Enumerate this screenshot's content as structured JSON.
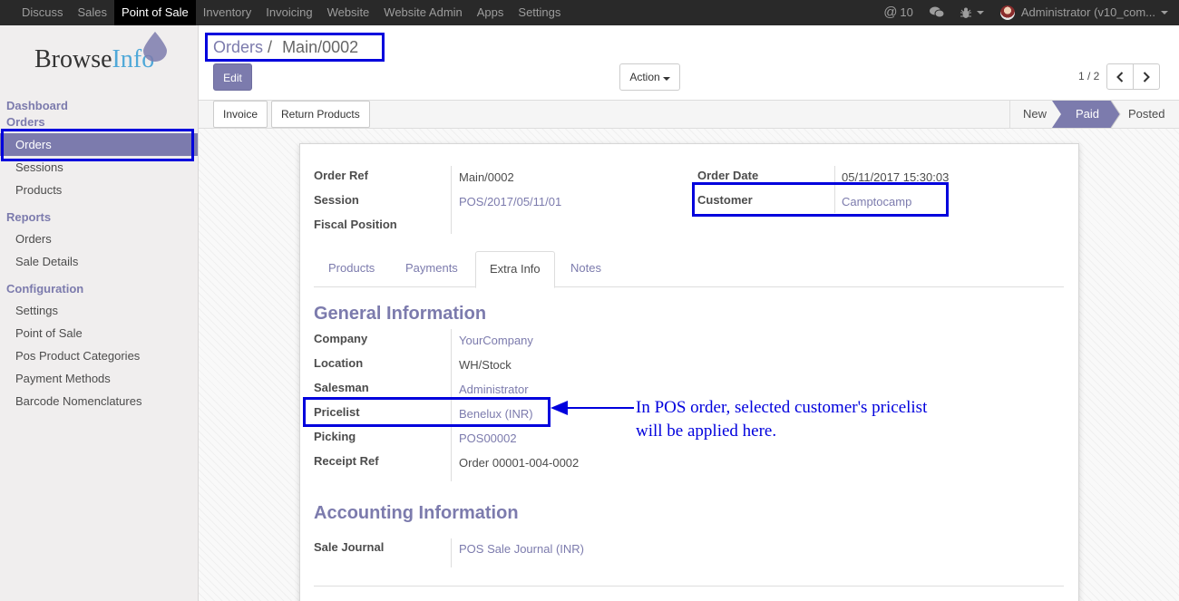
{
  "topbar": {
    "menu": [
      "Discuss",
      "Sales",
      "Point of Sale",
      "Inventory",
      "Invoicing",
      "Website",
      "Website Admin",
      "Apps",
      "Settings"
    ],
    "active_index": 2,
    "messages_count": "10",
    "user": "Administrator (v10_com..."
  },
  "sidebar": {
    "logo_browse": "Browse",
    "logo_info": "Info",
    "sections": [
      {
        "title": "Dashboard"
      },
      {
        "title": "Orders",
        "items": [
          "Orders",
          "Sessions",
          "Products"
        ]
      },
      {
        "title": "Reports",
        "items": [
          "Orders",
          "Sale Details"
        ]
      },
      {
        "title": "Configuration",
        "items": [
          "Settings",
          "Point of Sale",
          "Pos Product Categories",
          "Payment Methods",
          "Barcode Nomenclatures"
        ]
      }
    ]
  },
  "control_panel": {
    "breadcrumb_parent": "Orders",
    "breadcrumb_sep": "/",
    "breadcrumb_current": "Main/0002",
    "edit_label": "Edit",
    "action_label": "Action",
    "pager": "1 / 2"
  },
  "statusbar": {
    "buttons": [
      "Invoice",
      "Return Products"
    ],
    "stages": [
      "New",
      "Paid",
      "Posted"
    ],
    "active_stage": "Paid"
  },
  "form": {
    "order_ref_label": "Order Ref",
    "order_ref": "Main/0002",
    "session_label": "Session",
    "session": "POS/2017/05/11/01",
    "fiscal_position_label": "Fiscal Position",
    "order_date_label": "Order Date",
    "order_date": "05/11/2017 15:30:03",
    "customer_label": "Customer",
    "customer": "Camptocamp",
    "tabs": [
      "Products",
      "Payments",
      "Extra Info",
      "Notes"
    ],
    "active_tab": "Extra Info",
    "general_title": "General Information",
    "company_label": "Company",
    "company": "YourCompany",
    "location_label": "Location",
    "location": "WH/Stock",
    "salesman_label": "Salesman",
    "salesman": "Administrator",
    "pricelist_label": "Pricelist",
    "pricelist": "Benelux (INR)",
    "picking_label": "Picking",
    "picking": "POS00002",
    "receipt_ref_label": "Receipt Ref",
    "receipt_ref": "Order 00001-004-0002",
    "accounting_title": "Accounting Information",
    "sale_journal_label": "Sale Journal",
    "sale_journal": "POS Sale Journal (INR)"
  },
  "annotation": {
    "line1": "In POS order, selected customer's pricelist",
    "line2": "will be applied here.",
    "color": "#0000dd"
  },
  "colors": {
    "accent": "#7c7bad",
    "topbar": "#292929"
  }
}
